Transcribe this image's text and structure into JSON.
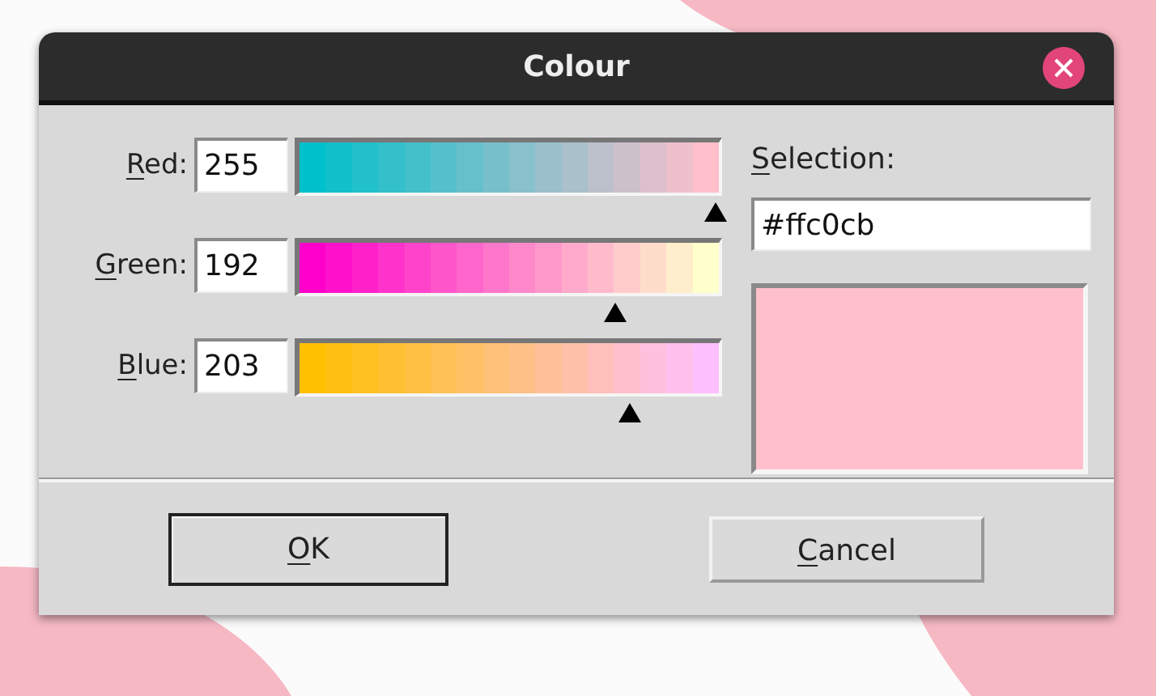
{
  "window": {
    "title": "Colour"
  },
  "channels": [
    {
      "label": "Red:",
      "value": "255",
      "level": 0.985
    },
    {
      "label": "Green:",
      "value": "192",
      "level": 0.75
    },
    {
      "label": "Blue:",
      "value": "203",
      "level": 0.785
    }
  ],
  "selection": {
    "label": "Selection:",
    "value": "#ffc0cb",
    "color": "#ffc0cb"
  },
  "buttons": [
    {
      "label": "OK",
      "default": true
    },
    {
      "label": "Cancel",
      "default": false
    }
  ]
}
